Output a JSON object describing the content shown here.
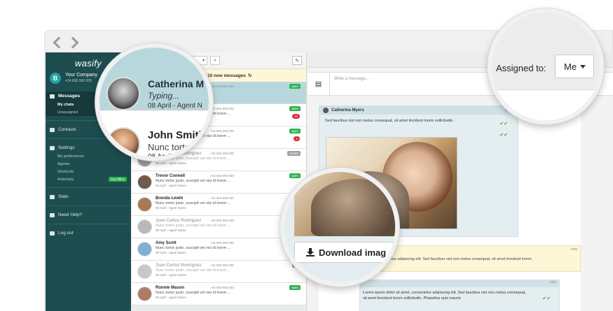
{
  "browser": {
    "back_icon": "chevron-left-icon",
    "forward_icon": "chevron-right-icon"
  },
  "sidebar": {
    "logo": "wasify",
    "company": {
      "initial": "B",
      "name": "Your Company",
      "phone": "+34 600 000 000"
    },
    "messages": {
      "label": "Messages",
      "sub": [
        "My chats",
        "Unassigned"
      ]
    },
    "contacts": "Contacts",
    "settings": {
      "label": "Settings",
      "sub": [
        "My preferences",
        "Agents",
        "Shortcuts",
        "Autoreply"
      ],
      "autoreply_badge": "Out Office"
    },
    "stats": "Stats",
    "help": "Need Help?",
    "logout": "Log out"
  },
  "chatlist": {
    "new_messages": "10 new messages",
    "rows": [
      {
        "name": "Catherina Myers",
        "phone": "+34 600 000 000",
        "preview": "Typing...",
        "date": "08 April - Agent Name",
        "status": "open",
        "count": ""
      },
      {
        "name": "John Smith",
        "phone": "+34 600 000 000",
        "preview": "Nunc tortor justo, suscipit vel nisi id lorem ...",
        "date": "08 April - Agent Name",
        "status": "open",
        "count": "12"
      },
      {
        "name": "John Smith",
        "phone": "+34 600 000 000",
        "preview": "Nunc tortor justo, suscipit vel nisi id lorem ...",
        "date": "08 April - Agent Name",
        "status": "open",
        "count": "1"
      },
      {
        "name": "Juan Carlos Rodriguez",
        "phone": "+34 600 000 000",
        "preview": "Nunc tortor justo, suscipit vel nisi id lorem ...",
        "date": "08 April - Agent Name",
        "status": "closed",
        "count": ""
      },
      {
        "name": "Trevor Connell",
        "phone": "+34 600 000 000",
        "preview": "Nunc tortor justo, suscipit vel nisi id lorem ...",
        "date": "08 April - Agent Name",
        "status": "open",
        "count": ""
      },
      {
        "name": "Brenda Lewin",
        "phone": "+34 600 000 000",
        "preview": "Nunc tortor justo, suscipit vel nisi id lorem ...",
        "date": "08 April - Agent Name",
        "status": "",
        "count": ""
      },
      {
        "name": "Juan Carlos Rodriguez",
        "phone": "+34 600 000 000",
        "preview": "Nunc tortor justo, suscipit vel nisi id lorem ...",
        "date": "08 April - Agent Name",
        "status": "",
        "count": ""
      },
      {
        "name": "Amy Scott",
        "phone": "+34 600 000 000",
        "preview": "Nunc tortor justo, suscipit vel nisi id lorem ...",
        "date": "08 April - Agent Name",
        "status": "",
        "count": ""
      },
      {
        "name": "Juan Carlos Rodriguez",
        "phone": "+34 600 000 000",
        "preview": "Nunc tortor justo, suscipit vel nisi id lorem ...",
        "date": "08 April - Agent Name",
        "status": "clo",
        "count": ""
      },
      {
        "name": "Ronnie Mason",
        "phone": "+34 600 000 000",
        "preview": "Nunc tortor justo, suscipit vel nisi id lorem ...",
        "date": "08 April - Agent Name",
        "status": "open",
        "count": ""
      }
    ]
  },
  "conversation": {
    "input_placeholder": "Write a message...",
    "assigned_label": "Assigned to:",
    "assigned_value": "Me",
    "incoming_name": "Catherina Myers",
    "incoming_time": "yeste",
    "incoming_text": "Sed faucibus nisl non metus consequat, sit amet tincidunt lorem sollicitudin.",
    "download_label": "Download imag",
    "outgoing_time": "now",
    "outgoing_text": "ctetur adipiscing elit. Sed faucibus nisl non metus consequat, sit amet tincidunt lorem",
    "incoming2_time": "now",
    "incoming2_text": "Lorem ipsum dolor sit amet, consectetur adipiscing elit. Sed faucibus nisl non metus consequat, sit amet tincidunt lorem sollicitudin. Phasellus quis mauris"
  },
  "magnified": {
    "name1": "Catherina M",
    "typing": "Typing...",
    "date1": "08 April - Agent N",
    "name2": "John Smith",
    "preview2": "Nunc tortor",
    "date2": "08 April -"
  }
}
